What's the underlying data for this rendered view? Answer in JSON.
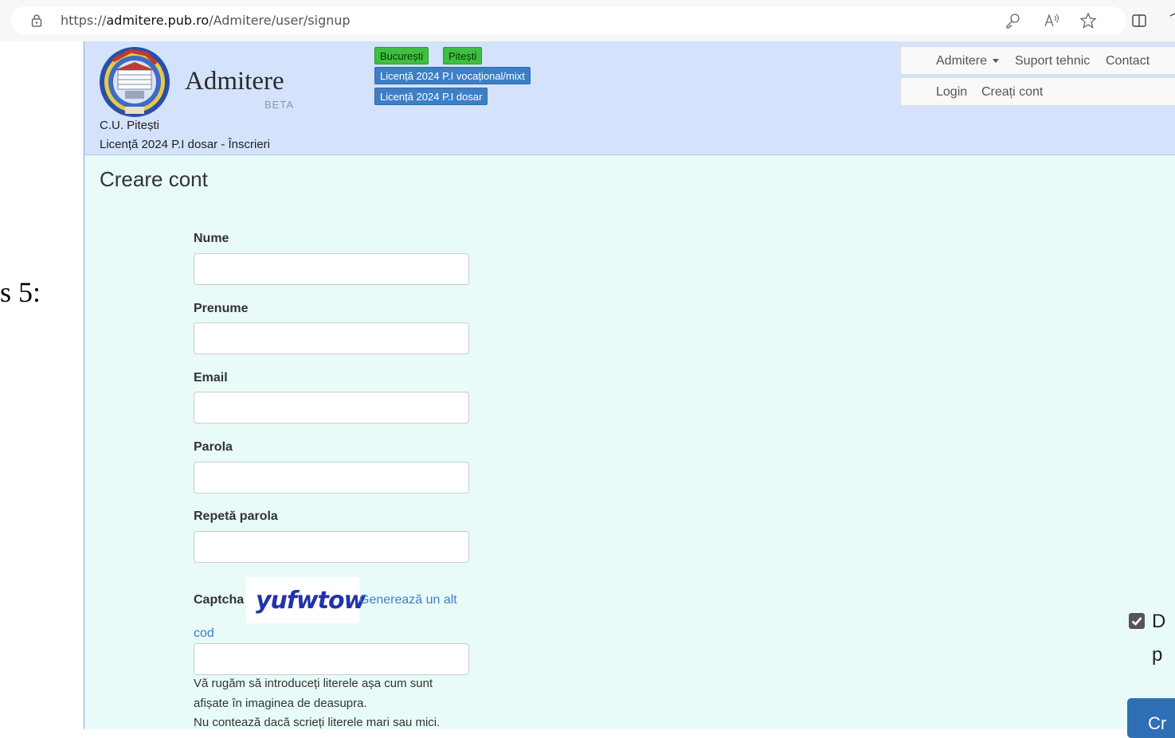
{
  "browser": {
    "url_prefix": "https://",
    "url_domain": "admitere.pub.ro",
    "url_path": "/Admitere/user/signup",
    "icons": [
      "lock-icon",
      "key-icon",
      "read-aloud-icon",
      "favorite-star-icon",
      "split-screen-icon"
    ]
  },
  "left_fragment": {
    "text": "s 5:"
  },
  "header": {
    "logo_title": "Admitere",
    "logo_beta": "BETA",
    "center_name": "C.U. Pitești",
    "session_name": "Licență 2024 P.I dosar - Înscrieri",
    "tags": {
      "bucuresti": "București",
      "pitesti": "Pitești",
      "licenta_vocational": "Licență 2024 P.I vocațional/mixt",
      "licenta_dosar": "Licență 2024 P.I dosar"
    },
    "nav": {
      "admitere": "Admitere",
      "suport": "Suport tehnic",
      "contact": "Contact",
      "login": "Login",
      "create_account": "Creați cont"
    }
  },
  "main": {
    "title": "Creare cont",
    "fields": {
      "nume": "Nume",
      "prenume": "Prenume",
      "email": "Email",
      "parola": "Parola",
      "repeta_parola": "Repetă parola",
      "captcha": "Captcha"
    },
    "captcha_code": "yufwtow",
    "captcha_link": {
      "part1": "Generează un alt",
      "part2": "cod"
    },
    "help": [
      "Vă rugăm să introduceți literele așa cum sunt",
      "afișate în imaginea de deasupra.",
      "Nu contează dacă scrieți literele mari sau mici."
    ],
    "right_fragment": {
      "line1": "D",
      "line2": "p"
    },
    "submit_fragment": "Cr",
    "colors": {
      "header_bg": "#d4e2fb",
      "main_bg": "#e8fbf9",
      "green_tag": "#3fbf3f",
      "blue_tag": "#3d7fc6",
      "submit": "#2f6fb6"
    }
  }
}
